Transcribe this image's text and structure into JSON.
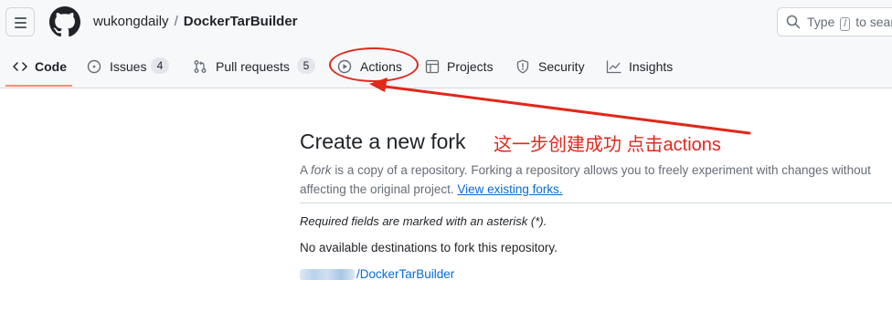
{
  "repo": {
    "owner": "wukongdaily",
    "separator": "/",
    "name": "DockerTarBuilder"
  },
  "search": {
    "prefix": "Type",
    "key": "/",
    "suffix": "to search"
  },
  "tabs": [
    {
      "label": "Code",
      "icon": "code-icon",
      "active": true
    },
    {
      "label": "Issues",
      "icon": "issue-opened-icon",
      "count": "4"
    },
    {
      "label": "Pull requests",
      "icon": "git-pull-request-icon",
      "count": "5"
    },
    {
      "label": "Actions",
      "icon": "play-icon"
    },
    {
      "label": "Projects",
      "icon": "table-icon"
    },
    {
      "label": "Security",
      "icon": "shield-icon"
    },
    {
      "label": "Insights",
      "icon": "graph-icon"
    }
  ],
  "fork": {
    "title": "Create a new fork",
    "desc_prefix": "A",
    "desc_em": "fork",
    "desc_rest": "is a copy of a repository. Forking a repository allows you to freely experiment with changes without",
    "desc_line2": "affecting the original project.",
    "view_forks": "View existing forks.",
    "required": "Required fields are marked with an asterisk (*).",
    "no_destinations": "No available destinations to fork this repository.",
    "fork_link": "/DockerTarBuilder"
  },
  "annotation": {
    "text": "这一步创建成功  点击actions",
    "color": "#e0281b"
  },
  "colors": {
    "accent_underline": "#fd8c73",
    "link": "#0969da",
    "annotation_red": "#e0281b"
  }
}
